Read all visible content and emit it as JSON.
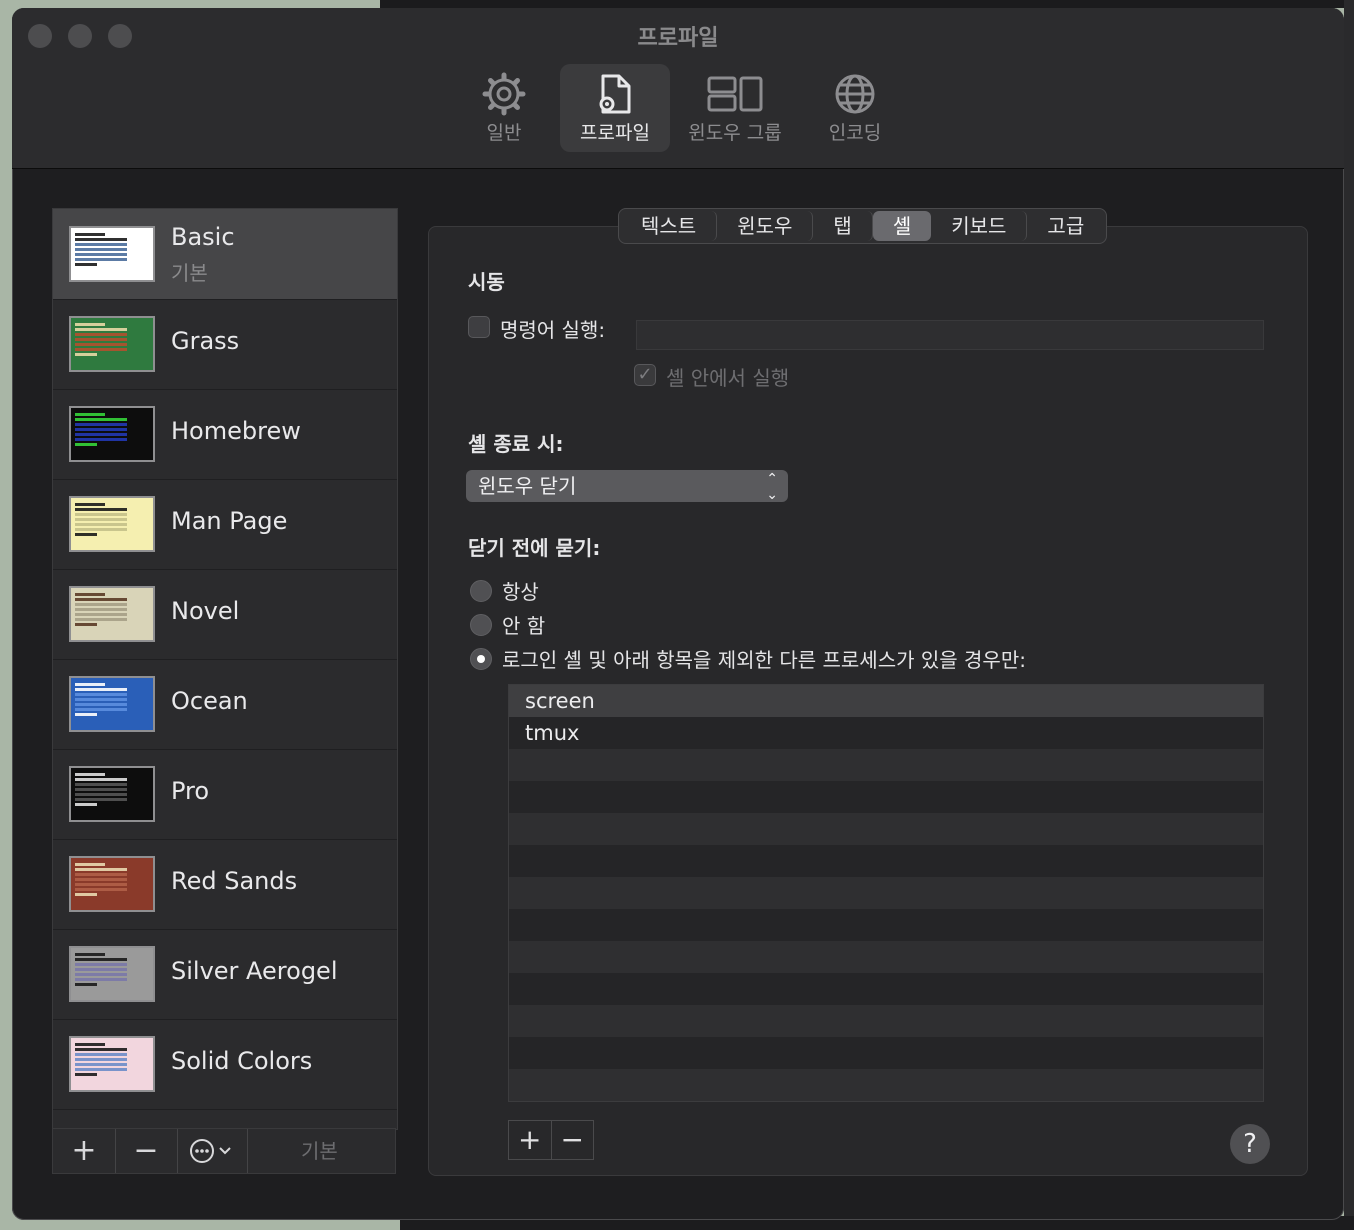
{
  "window": {
    "title": "프로파일"
  },
  "toolbar": {
    "items": [
      {
        "label": "일반",
        "icon": "gear-icon",
        "active": false
      },
      {
        "label": "프로파일",
        "icon": "profile-doc-icon",
        "active": true
      },
      {
        "label": "윈도우 그룹",
        "icon": "window-group-icon",
        "active": false
      },
      {
        "label": "인코딩",
        "icon": "globe-icon",
        "active": false
      }
    ]
  },
  "sidebar": {
    "profiles": [
      {
        "name": "Basic",
        "subtitle": "기본",
        "selected": true,
        "thumb_bg": "#ffffff",
        "thumb_fg": "#1a1a1a",
        "thumb_hl": "#4a6d9b"
      },
      {
        "name": "Grass",
        "subtitle": "",
        "selected": false,
        "thumb_bg": "#2f7a3f",
        "thumb_fg": "#e9d9a6",
        "thumb_hl": "#b3502d"
      },
      {
        "name": "Homebrew",
        "subtitle": "",
        "selected": false,
        "thumb_bg": "#0d0d0d",
        "thumb_fg": "#35d43a",
        "thumb_hl": "#2238b4"
      },
      {
        "name": "Man Page",
        "subtitle": "",
        "selected": false,
        "thumb_bg": "#f5efb0",
        "thumb_fg": "#1a1a1a",
        "thumb_hl": "#c4c08a"
      },
      {
        "name": "Novel",
        "subtitle": "",
        "selected": false,
        "thumb_bg": "#d9d4b8",
        "thumb_fg": "#5a3a26",
        "thumb_hl": "#a59f86"
      },
      {
        "name": "Ocean",
        "subtitle": "",
        "selected": false,
        "thumb_bg": "#2a5fb8",
        "thumb_fg": "#ffffff",
        "thumb_hl": "#5c8fe0"
      },
      {
        "name": "Pro",
        "subtitle": "",
        "selected": false,
        "thumb_bg": "#0d0d0d",
        "thumb_fg": "#e0e0e0",
        "thumb_hl": "#555555"
      },
      {
        "name": "Red Sands",
        "subtitle": "",
        "selected": false,
        "thumb_bg": "#8a3a2a",
        "thumb_fg": "#e9d9b0",
        "thumb_hl": "#b06048"
      },
      {
        "name": "Silver Aerogel",
        "subtitle": "",
        "selected": false,
        "thumb_bg": "#9a9a9a",
        "thumb_fg": "#1a1a1a",
        "thumb_hl": "#7a78a8"
      },
      {
        "name": "Solid Colors",
        "subtitle": "",
        "selected": false,
        "thumb_bg": "#f2d6de",
        "thumb_fg": "#1a1a1a",
        "thumb_hl": "#6b8cc8"
      }
    ],
    "footer": {
      "add": "+",
      "remove": "−",
      "default_label": "기본"
    }
  },
  "tabs": [
    {
      "label": "텍스트",
      "active": false
    },
    {
      "label": "윈도우",
      "active": false
    },
    {
      "label": "탭",
      "active": false
    },
    {
      "label": "셸",
      "active": true
    },
    {
      "label": "키보드",
      "active": false
    },
    {
      "label": "고급",
      "active": false
    }
  ],
  "shell": {
    "startup_title": "시동",
    "run_command_label": "명령어 실행:",
    "run_command_value": "",
    "run_in_shell_label": "셸 안에서 실행",
    "on_exit_title": "셸 종료 시:",
    "on_exit_selected": "윈도우 닫기",
    "ask_before_close_title": "닫기 전에 묻기:",
    "ask_options": [
      {
        "label": "항상",
        "selected": false
      },
      {
        "label": "안 함",
        "selected": false
      },
      {
        "label": "로그인 셸 및 아래 항목을 제외한 다른 프로세스가 있을 경우만:",
        "selected": true
      }
    ],
    "processes": [
      "screen",
      "tmux"
    ],
    "list_add": "+",
    "list_remove": "−",
    "help": "?"
  }
}
